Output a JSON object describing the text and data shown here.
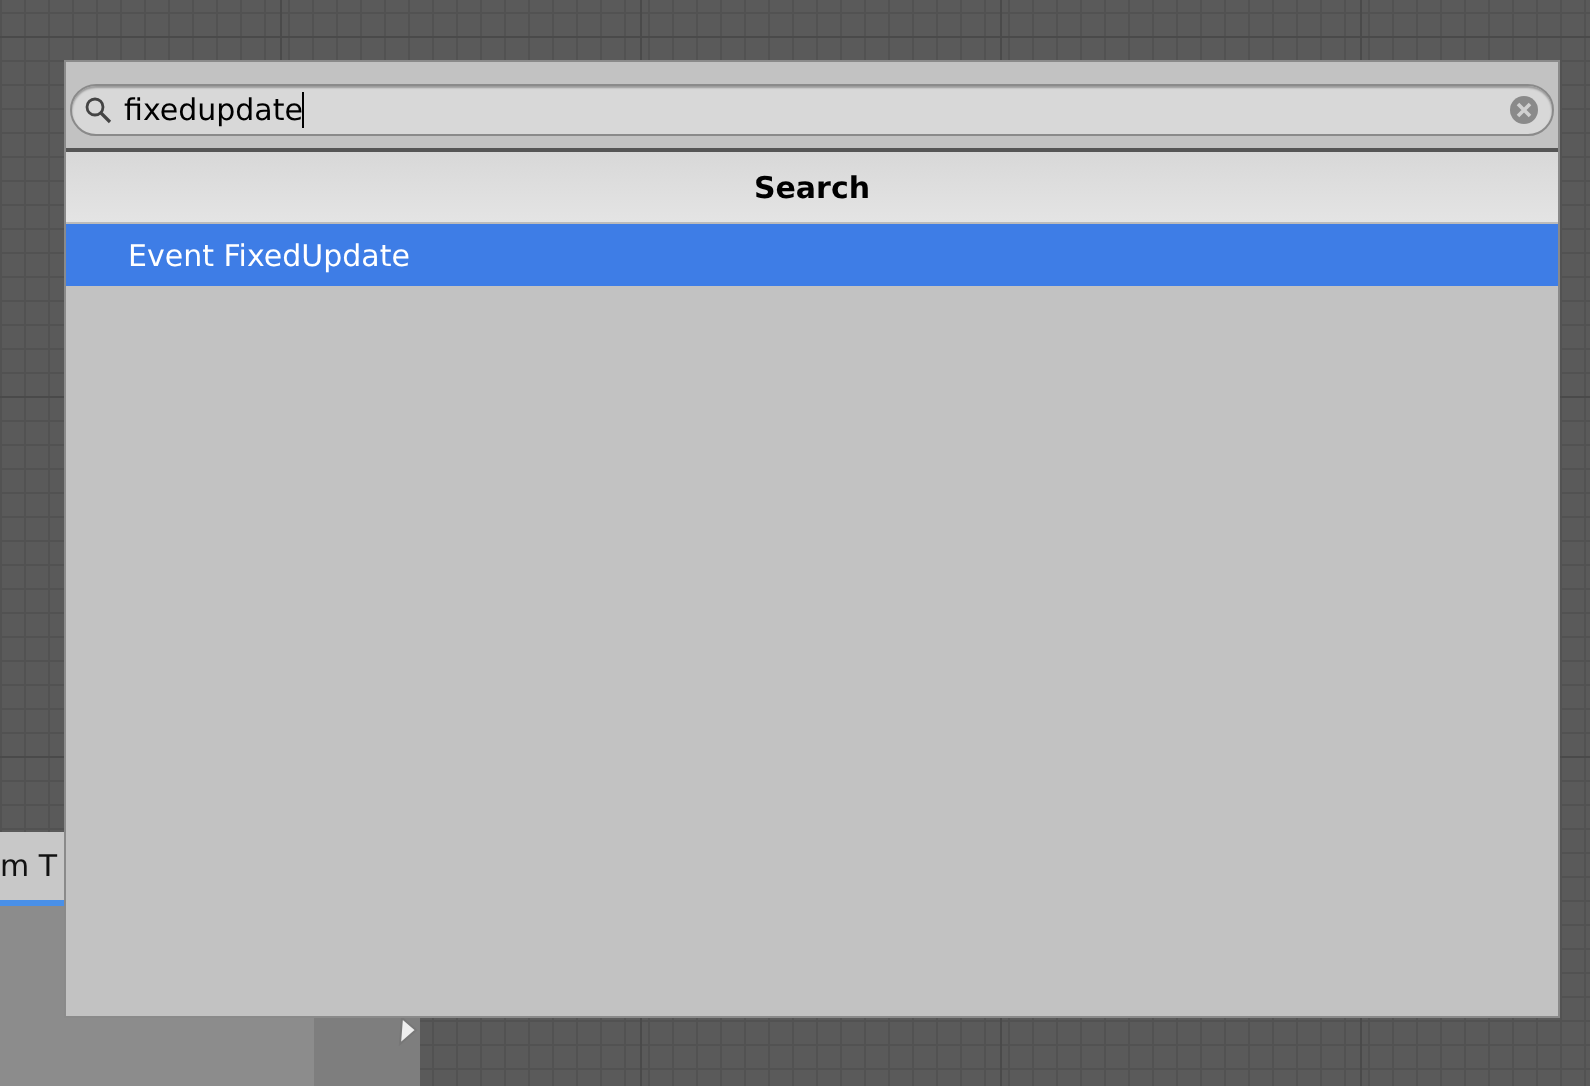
{
  "background_node": {
    "title": "m T"
  },
  "search": {
    "value": "fixedupdate"
  },
  "header": {
    "title": "Search"
  },
  "results": [
    {
      "label": "Event FixedUpdate",
      "selected": true
    }
  ]
}
